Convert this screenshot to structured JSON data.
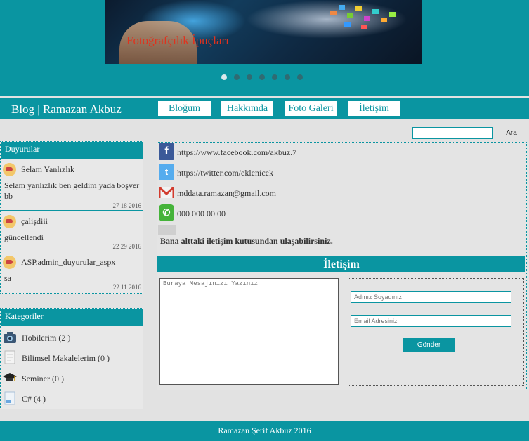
{
  "slider": {
    "caption": "Fotoğrafçılık İpuçları",
    "slide_count": 7,
    "active_slide": 1
  },
  "nav": {
    "brand": "Blog | Ramazan Akbuz",
    "items": [
      {
        "label": "Bloğum"
      },
      {
        "label": "Hakkımda"
      },
      {
        "label": "Foto Galeri"
      },
      {
        "label": "İletişim"
      }
    ]
  },
  "search": {
    "value": "",
    "button_label": "Ara"
  },
  "announcements": {
    "title": "Duyurular",
    "items": [
      {
        "title": "Selam Yanlızlık",
        "body": "Selam yanlızlık ben geldim yada boşver bb",
        "date": "27 18 2016"
      },
      {
        "title": "çalişdiii",
        "body": "güncellendi",
        "date": "22 29 2016"
      },
      {
        "title": "ASP.admin_duyurular_aspx",
        "body": "sa",
        "date": "22 11 2016"
      }
    ]
  },
  "categories": {
    "title": "Kategoriler",
    "items": [
      {
        "label": "Hobilerim (2 )",
        "icon": "camera-icon"
      },
      {
        "label": "Bilimsel Makalelerim (0 )",
        "icon": "document-icon"
      },
      {
        "label": "Seminer (0 )",
        "icon": "graduation-cap-icon"
      },
      {
        "label": "C# (4 )",
        "icon": "code-file-icon"
      }
    ]
  },
  "contact": {
    "facebook": "https://www.facebook.com/akbuz.7",
    "twitter": "https://twitter.com/eklenicek",
    "email": "mddata.ramazan@gmail.com",
    "phone": "000 000 00 00",
    "note": "Bana alttaki iletişim kutusundan ulaşabilirsiniz."
  },
  "contact_form": {
    "heading": "İletişim",
    "message_placeholder": "Buraya Mesajınızı Yazınız",
    "name_placeholder": "Adınız Soyadınız",
    "email_placeholder": "Email Adresiniz",
    "submit_label": "Gönder"
  },
  "footer": {
    "text": "Ramazan Şerif Akbuz 2016"
  },
  "colors": {
    "accent": "#0a95a1",
    "background": "#e2e2e2",
    "caption": "#e0321e"
  }
}
